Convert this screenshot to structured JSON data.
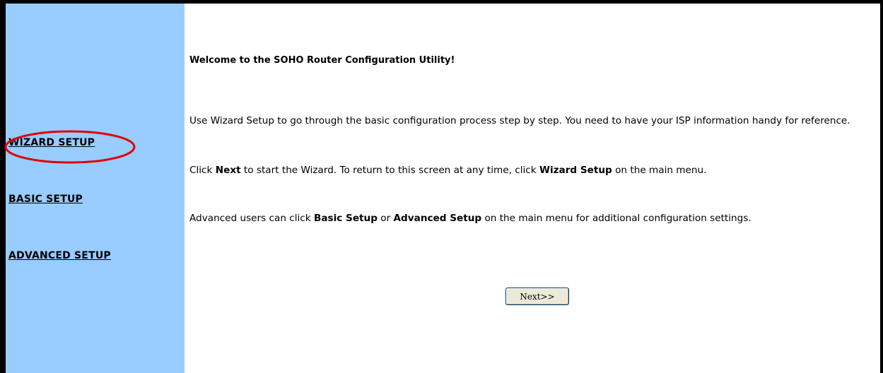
{
  "sidebar": {
    "items": [
      {
        "label": "WIZARD SETUP"
      },
      {
        "label": "BASIC SETUP"
      },
      {
        "label": "ADVANCED SETUP"
      }
    ]
  },
  "main": {
    "welcome_title": "Welcome to the SOHO Router Configuration Utility!",
    "paragraph1": {
      "text": "Use Wizard Setup to go through the basic configuration process step by step. You need to have your ISP information handy for reference."
    },
    "paragraph2": {
      "text_before_next": "Click ",
      "bold_next": "Next",
      "text_after_next": " to start the Wizard. To return to this screen at any time, click ",
      "bold_wizard_setup": "Wizard Setup",
      "text_end": " on the main menu."
    },
    "paragraph3": {
      "text_start": "Advanced users can click ",
      "bold_basic_setup": "Basic Setup",
      "text_or": " or ",
      "bold_advanced_setup": "Advanced Setup",
      "text_end": " on the main menu for additional configuration settings."
    },
    "next_button_label": "Next>>"
  },
  "annotation": {
    "highlight_color": "#e00000"
  },
  "colors": {
    "sidebar_bg": "#99ccff",
    "frame_border": "#000000"
  }
}
